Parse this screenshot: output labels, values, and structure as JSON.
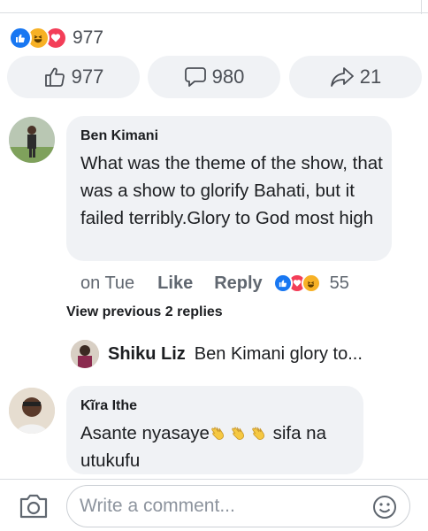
{
  "reactions": {
    "count": "977",
    "icons": [
      "like-icon",
      "haha-icon",
      "love-icon"
    ],
    "colors": {
      "like": "#1877f2",
      "haha": "#f7b125",
      "love": "#f33e58"
    }
  },
  "actions": {
    "like_count": "977",
    "comment_count": "980",
    "share_count": "21"
  },
  "comments": [
    {
      "author": "Ben Kimani",
      "text": "What was the theme of the show, that was a show to glorify Bahati, but it failed terribly.Glory to God most high",
      "time": "on Tue",
      "like_label": "Like",
      "reply_label": "Reply",
      "reaction_count": "55"
    },
    {
      "author": "Kĩra Ithe",
      "text_before": "Asante nyasaye",
      "text_after": " sifa na utukufu",
      "emoji": [
        "clapping-hands-icon",
        "clapping-hands-icon",
        "clapping-hands-icon"
      ]
    }
  ],
  "view_replies": "View previous 2 replies",
  "reply": {
    "author": "Shiku Liz",
    "text": "Ben Kimani  glory to..."
  },
  "composer": {
    "placeholder": "Write a comment..."
  }
}
